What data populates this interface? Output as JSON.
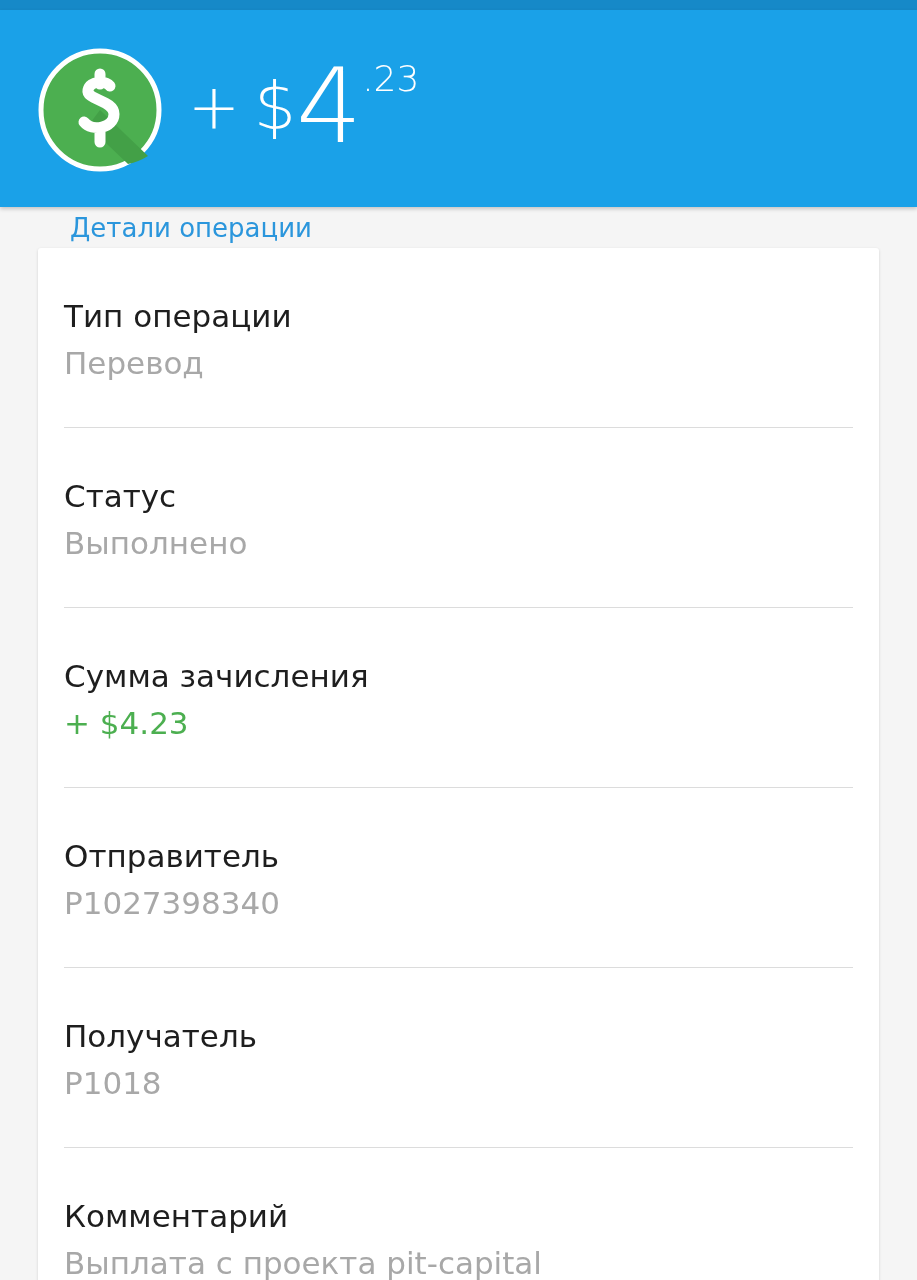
{
  "header": {
    "amount": {
      "sign": "+",
      "currency": "$",
      "whole": "4",
      "cents": ".23"
    }
  },
  "section_title": "Детали операции",
  "fields": [
    {
      "label": "Тип операции",
      "value": "Перевод",
      "kind": "plain"
    },
    {
      "label": "Статус",
      "value": "Выполнено",
      "kind": "plain"
    },
    {
      "label": "Сумма зачисления",
      "value": "+ $4.23",
      "kind": "credit"
    },
    {
      "label": "Отправитель",
      "value": "P1027398340",
      "kind": "plain"
    },
    {
      "label": "Получатель",
      "value": "P1018",
      "kind": "plain"
    },
    {
      "label": "Комментарий",
      "value": "Выплата с проекта pit-capital",
      "kind": "plain"
    }
  ]
}
